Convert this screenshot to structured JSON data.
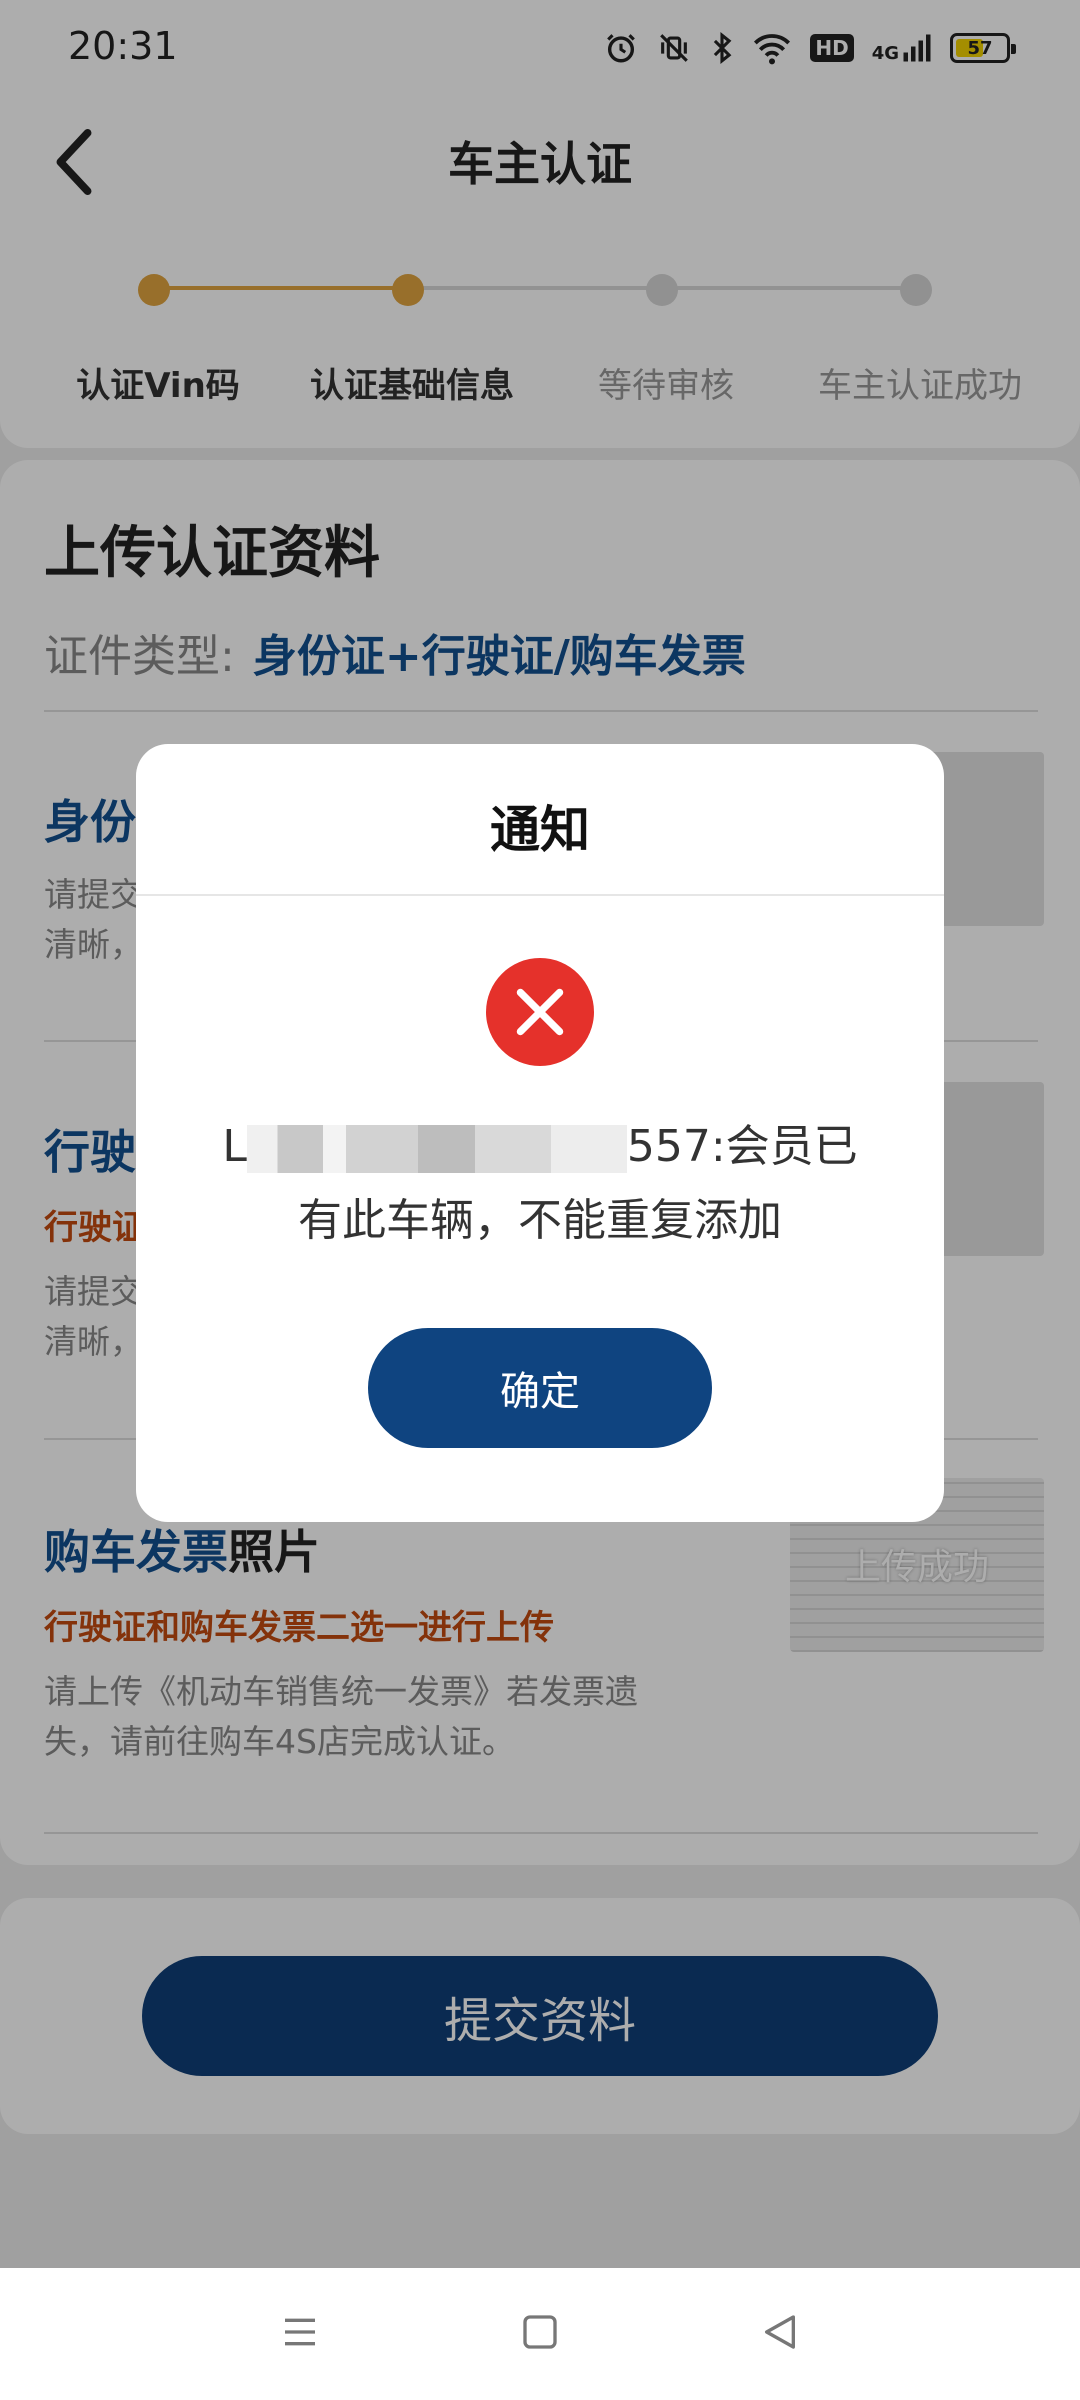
{
  "status_bar": {
    "time": "20:31",
    "network": "4G",
    "hd": "HD",
    "battery": "57",
    "battery_level": 0.57
  },
  "header": {
    "title": "车主认证",
    "steps": [
      {
        "label": "认证Vin码",
        "done": true
      },
      {
        "label": "认证基础信息",
        "done": true
      },
      {
        "label": "等待审核",
        "done": false
      },
      {
        "label": "车主认证成功",
        "done": false
      }
    ]
  },
  "content": {
    "section_title": "上传认证资料",
    "doc_type_label": "证件类型:",
    "doc_type_value": "身份证+行驶证/购车发票",
    "items": [
      {
        "title": "身份",
        "desc": "请提交\n清晰，"
      },
      {
        "title": "行驶",
        "note": "行驶证",
        "desc": "请提交\n清晰，"
      },
      {
        "title": "购车发票",
        "title_suffix": "照片",
        "note": "行驶证和购车发票二选一进行上传",
        "desc": "请上传《机动车销售统一发票》若发票遗失，请前往购车4S店完成认证。",
        "thumb_label": "上传成功"
      }
    ]
  },
  "footer": {
    "submit_label": "提交资料"
  },
  "modal": {
    "title": "通知",
    "msg_prefix": "L",
    "msg_suffix": "557:会员已",
    "msg_line2": "有此车辆，不能重复添加",
    "confirm_label": "确定"
  }
}
